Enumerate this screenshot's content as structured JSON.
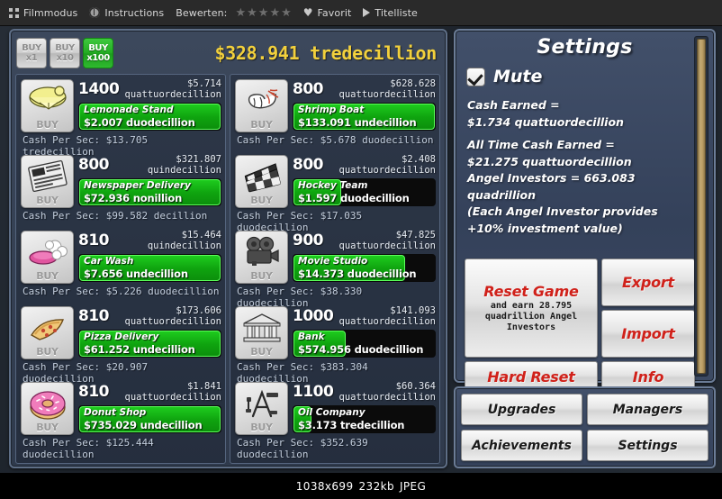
{
  "viewer": {
    "items": [
      {
        "icon": "film-mode-icon",
        "label": "Filmmodus"
      },
      {
        "icon": "instructions-icon",
        "label": "Instructions"
      },
      {
        "icon": "rating-stars-icon",
        "label": "Bewerten:"
      },
      {
        "icon": "heart-icon",
        "label": "Favorit"
      },
      {
        "icon": "play-icon",
        "label": "Titelliste"
      }
    ],
    "star_glyph": "★",
    "heart_glyph": "♥",
    "status": {
      "dimensions": "1038x699",
      "size": "232kb",
      "format": "JPEG"
    }
  },
  "game": {
    "buy_buttons": [
      {
        "line1": "BUY",
        "line2": "x1",
        "active": false
      },
      {
        "line1": "BUY",
        "line2": "x10",
        "active": false
      },
      {
        "line1": "BUY",
        "line2": "x100",
        "active": true
      }
    ],
    "cash_total": "$328.941 tredecillion",
    "accent_yellow": "#f2d03c",
    "accent_green": "#1ecb1e",
    "accent_red": "#d0211a"
  },
  "businesses_left": [
    {
      "icon": "lemonade-icon",
      "count": "1400",
      "price": "$5.714",
      "price_unit": "quattuordecillion",
      "name": "Lemonade Stand",
      "value": "$2.007 duodecillion",
      "progress": 100,
      "cps_label": "Cash Per Sec:",
      "cps_value": "$13.705 tredecillion"
    },
    {
      "icon": "newspaper-icon",
      "count": "800",
      "price": "$321.807",
      "price_unit": "quindecillion",
      "name": "Newspaper Delivery",
      "value": "$72.936 nonillion",
      "progress": 100,
      "cps_label": "Cash Per Sec:",
      "cps_value": "$99.582 decillion"
    },
    {
      "icon": "carwash-icon",
      "count": "810",
      "price": "$15.464",
      "price_unit": "quindecillion",
      "name": "Car Wash",
      "value": "$7.656 undecillion",
      "progress": 100,
      "cps_label": "Cash Per Sec:",
      "cps_value": "$5.226 duodecillion"
    },
    {
      "icon": "pizza-icon",
      "count": "810",
      "price": "$173.606",
      "price_unit": "quattuordecillion",
      "name": "Pizza Delivery",
      "value": "$61.252 undecillion",
      "progress": 100,
      "cps_label": "Cash Per Sec:",
      "cps_value": "$20.907 duodecillion"
    },
    {
      "icon": "donut-icon",
      "count": "810",
      "price": "$1.841",
      "price_unit": "quattuordecillion",
      "name": "Donut Shop",
      "value": "$735.029 undecillion",
      "progress": 100,
      "cps_label": "Cash Per Sec:",
      "cps_value": "$125.444 duodecillion"
    }
  ],
  "businesses_right": [
    {
      "icon": "shrimp-icon",
      "count": "800",
      "price": "$628.628",
      "price_unit": "quattuordecillion",
      "name": "Shrimp Boat",
      "value": "$133.091 undecillion",
      "progress": 100,
      "cps_label": "Cash Per Sec:",
      "cps_value": "$5.678 duodecillion"
    },
    {
      "icon": "hockey-icon",
      "count": "800",
      "price": "$2.408",
      "price_unit": "quattuordecillion",
      "name": "Hockey Team",
      "value": "$1.597 duodecillion",
      "progress": 34,
      "cps_label": "Cash Per Sec:",
      "cps_value": "$17.035 duodecillion"
    },
    {
      "icon": "movie-camera-icon",
      "count": "900",
      "price": "$47.825",
      "price_unit": "quattuordecillion",
      "name": "Movie Studio",
      "value": "$14.373 duodecillion",
      "progress": 79,
      "cps_label": "Cash Per Sec:",
      "cps_value": "$38.330 duodecillion"
    },
    {
      "icon": "bank-icon",
      "count": "1000",
      "price": "$141.093",
      "price_unit": "quattuordecillion",
      "name": "Bank",
      "value": "$574.956 duodecillion",
      "progress": 37,
      "cps_label": "Cash Per Sec:",
      "cps_value": "$383.304 duodecillion"
    },
    {
      "icon": "oil-company-icon",
      "count": "1100",
      "price": "$60.364",
      "price_unit": "quattuordecillion",
      "name": "Oil Company",
      "value": "$3.173 tredecillion",
      "progress": 13,
      "cps_label": "Cash Per Sec:",
      "cps_value": "$352.639 duodecillion"
    }
  ],
  "settings": {
    "title": "Settings",
    "mute_label": "Mute",
    "mute_checked": true,
    "stats": [
      "Cash Earned =",
      "$1.734 quattuordecillion",
      "",
      "All Time Cash Earned =",
      "$21.275 quattuordecillion",
      "Angel Investors = 663.083",
      "quadrillion",
      "(Each Angel Investor provides",
      "+10% investment value)"
    ],
    "reset_game_label": "Reset Game",
    "reset_game_sub": "and earn 28.795 quadrillion Angel Investors",
    "hard_reset_label": "Hard Reset",
    "export_label": "Export",
    "import_label": "Import",
    "info_label": "Info"
  },
  "nav": {
    "buttons": [
      {
        "label": "Upgrades"
      },
      {
        "label": "Managers"
      },
      {
        "label": "Achievements"
      },
      {
        "label": "Settings"
      }
    ]
  }
}
